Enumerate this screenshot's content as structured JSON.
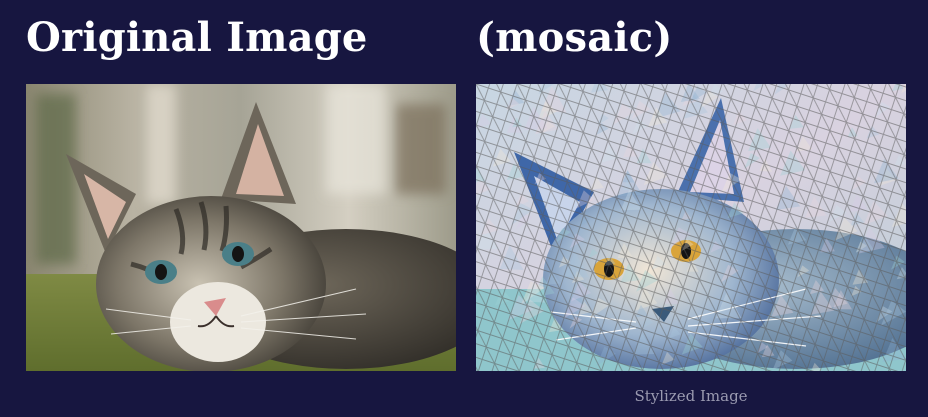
{
  "original": {
    "heading": "Original Image",
    "image_subject": "photo of a tabby kitten lying on a green blanket"
  },
  "stylized": {
    "heading": "(mosaic)",
    "caption": "Stylized Image",
    "image_subject": "mosaic-style rendering of the tabby kitten"
  },
  "colors": {
    "background": "#171640",
    "heading_text": "#ffffff",
    "caption_text": "#9a9ab0"
  }
}
